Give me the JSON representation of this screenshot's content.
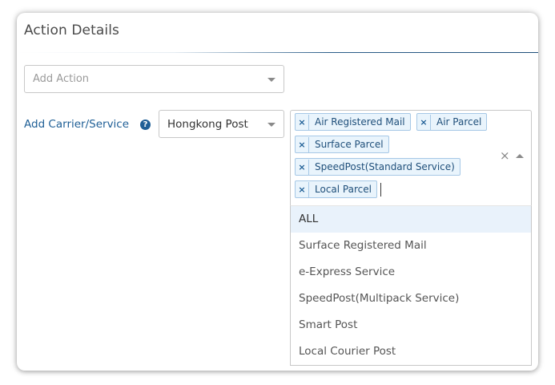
{
  "header": {
    "title": "Action Details"
  },
  "action": {
    "placeholder": "Add Action"
  },
  "carrier": {
    "label": "Add Carrier/Service",
    "help_icon": "question-circle-icon",
    "selected": "Hongkong Post"
  },
  "services": {
    "selected_tags": [
      {
        "remove": "×",
        "label": "Air Registered Mail"
      },
      {
        "remove": "×",
        "label": "Air Parcel"
      },
      {
        "remove": "×",
        "label": "Surface Parcel"
      },
      {
        "remove": "×",
        "label": "SpeedPost(Standard Service)"
      },
      {
        "remove": "×",
        "label": "Local Parcel"
      }
    ],
    "clear": "×",
    "options": [
      {
        "label": "ALL",
        "highlighted": true
      },
      {
        "label": "Surface Registered Mail"
      },
      {
        "label": "e-Express Service"
      },
      {
        "label": "SpeedPost(Multipack Service)"
      },
      {
        "label": "Smart Post"
      },
      {
        "label": "Local Courier Post"
      }
    ]
  },
  "colors": {
    "link": "#1f5f96",
    "tag_bg": "#e9f4fc",
    "tag_border": "#a6c8e6",
    "highlight": "#e9f2fb"
  }
}
